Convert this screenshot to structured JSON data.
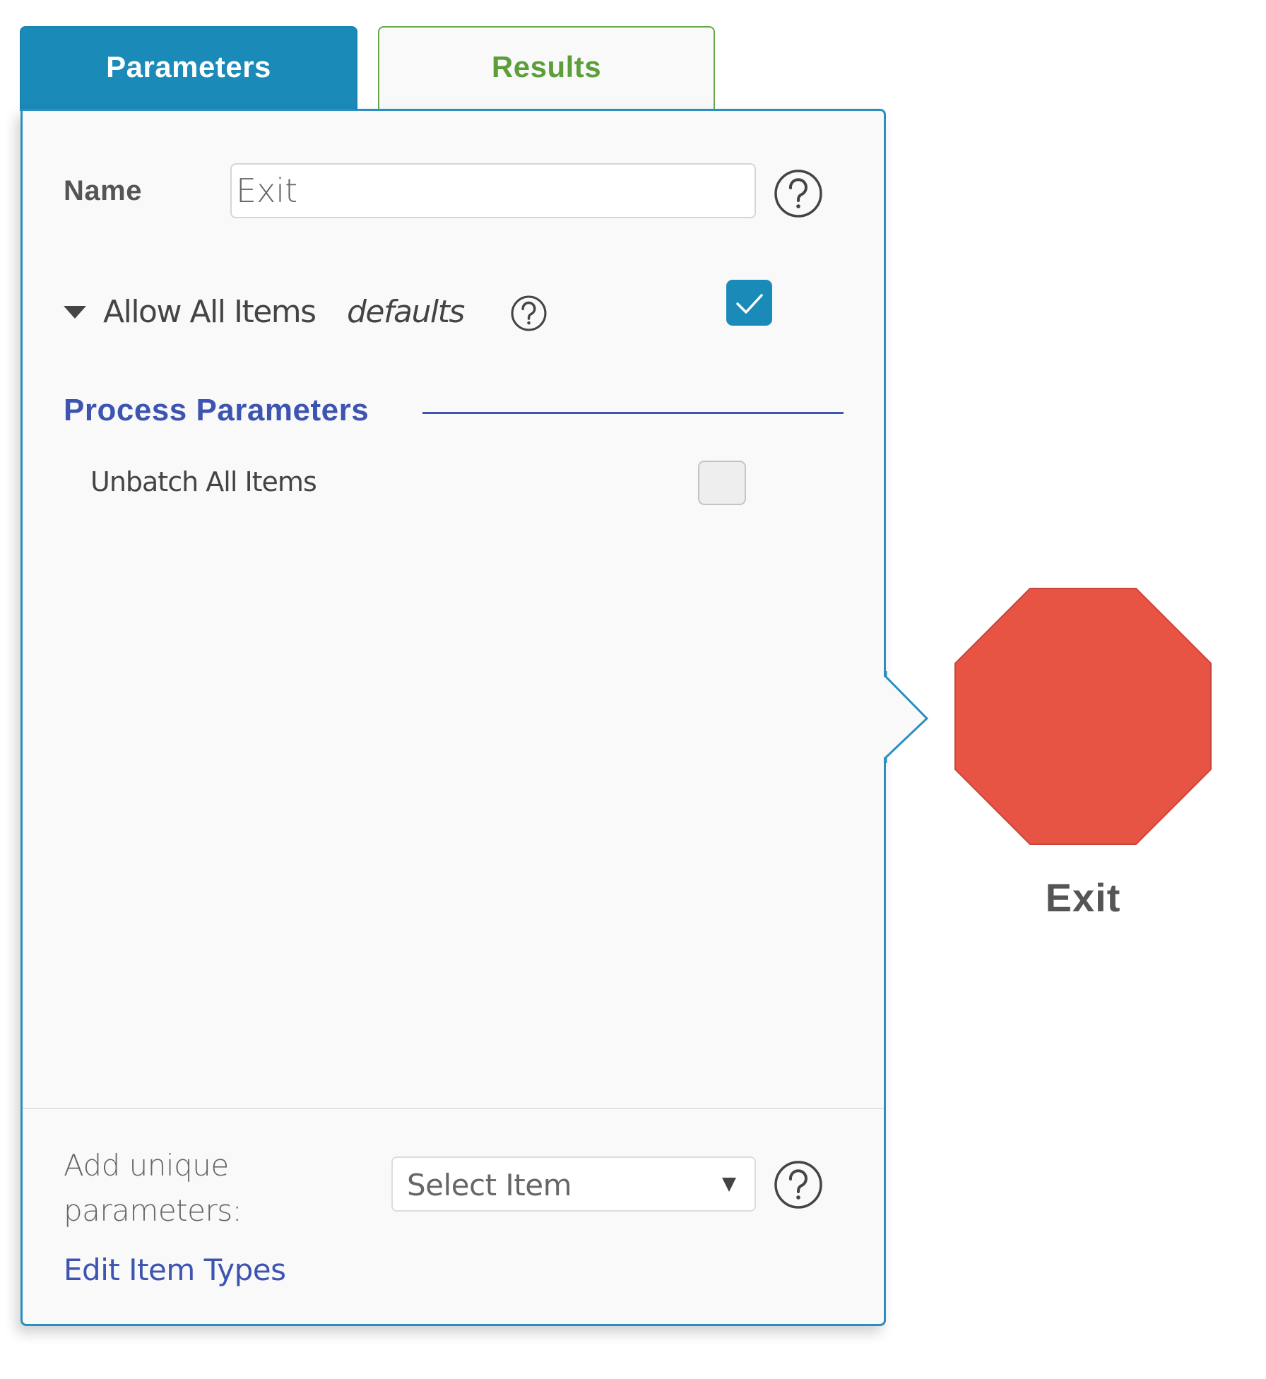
{
  "tabs": [
    {
      "label": "Parameters",
      "active": true
    },
    {
      "label": "Results",
      "active": false
    }
  ],
  "form": {
    "name_label": "Name",
    "name_value": "Exit",
    "allow_all_items": {
      "label": "Allow All Items",
      "tag": "defaults",
      "checked": true
    },
    "section_title": "Process Parameters",
    "unbatch_all_items": {
      "label": "Unbatch All Items",
      "checked": false
    }
  },
  "footer": {
    "add_unique_label": "Add unique parameters:",
    "select": {
      "selected": "Select Item"
    },
    "edit_link": "Edit Item Types"
  },
  "node": {
    "label": "Exit",
    "shape": "octagon",
    "color": "#e85444"
  },
  "colors": {
    "accent": "#1a8ab8",
    "results_tab": "#5c9e3a",
    "section_heading": "#3d54b0"
  },
  "icons": {
    "help": "help-circle-icon",
    "toggle": "caret-down-icon",
    "check": "checkmark-icon",
    "dropdown": "caret-down-icon"
  }
}
